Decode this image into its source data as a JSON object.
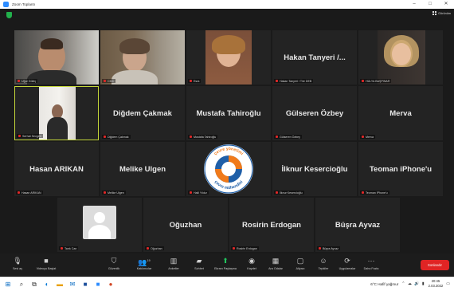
{
  "window": {
    "title": "Zoom Toplantı",
    "controls": [
      "–",
      "□",
      "✕"
    ]
  },
  "meeting": {
    "gallery_view_label": "Görünüm"
  },
  "participants": [
    {
      "id": "ugur",
      "label": "Uğur Güleç",
      "display": "",
      "video": true
    },
    {
      "id": "cmc",
      "label": "CMC",
      "display": "",
      "video": true
    },
    {
      "id": "esra",
      "label": "Esra",
      "display": "",
      "video": true
    },
    {
      "id": "hakan",
      "label": "Hakan Tanyeri / Tire DEB",
      "display": "Hakan Tanyeri /...",
      "video": false
    },
    {
      "id": "hulya",
      "label": "HÜLYA BAŞPINAR",
      "display": "",
      "video": true
    },
    {
      "id": "serhat",
      "label": "Serhat Sevgen",
      "display": "",
      "video": true
    },
    {
      "id": "digdem",
      "label": "Diğdem Çakmak",
      "display": "Diğdem Çakmak",
      "video": false
    },
    {
      "id": "mustafa",
      "label": "Mustafa Tahiroğlu",
      "display": "Mustafa Tahiroğlu",
      "video": false
    },
    {
      "id": "gulseren",
      "label": "Gülseren Özbey",
      "display": "Gülseren Özbey",
      "video": false
    },
    {
      "id": "merva",
      "label": "Merva",
      "display": "Merva",
      "video": false
    },
    {
      "id": "hasan",
      "label": "Hasan ARIKAN",
      "display": "Hasan ARIKAN",
      "video": false
    },
    {
      "id": "melike",
      "label": "Melike Ulgen",
      "display": "Melike Ulgen",
      "video": false
    },
    {
      "id": "halil",
      "label": "Halil Yıldız",
      "display": "",
      "video": false
    },
    {
      "id": "ilknur",
      "label": "İlknur Kesercioğlu",
      "display": "İlknur Kesercioğlu",
      "video": false
    },
    {
      "id": "teoman",
      "label": "Teoman iPhone'u",
      "display": "Teoman iPhone'u",
      "video": false
    },
    {
      "id": "tarik",
      "label": "Tarık Can",
      "display": "",
      "video": false
    },
    {
      "id": "oguzhan",
      "label": "Oğuzhan",
      "display": "Oğuzhan",
      "video": false
    },
    {
      "id": "rosirin",
      "label": "Rosirin Erdogan",
      "display": "Rosirin Erdogan",
      "video": false
    },
    {
      "id": "busra",
      "label": "Büşra Ayvaz",
      "display": "Büşra Ayvaz",
      "video": false
    }
  ],
  "logo": {
    "text_top": "çevre yönetimi",
    "text_bottom": "çevre mühendisi"
  },
  "toolbar": {
    "items": [
      {
        "label": "Sesi aç",
        "icon": "microphone-muted-icon"
      },
      {
        "label": "Videoyu Başlat",
        "icon": "video-off-icon"
      },
      {
        "label": "Güvenlik",
        "icon": "shield-icon"
      },
      {
        "label": "Katılımcılar",
        "icon": "participants-icon",
        "count": "19"
      },
      {
        "label": "Anketler",
        "icon": "polls-icon"
      },
      {
        "label": "Sohbet",
        "icon": "chat-icon"
      },
      {
        "label": "Ekranı Paylaşma",
        "icon": "share-screen-icon"
      },
      {
        "label": "Kaydet",
        "icon": "record-icon"
      },
      {
        "label": "Ara Odalar",
        "icon": "breakout-rooms-icon"
      },
      {
        "label": "Altyazı",
        "icon": "caption-icon"
      },
      {
        "label": "Tepkiler",
        "icon": "reactions-icon"
      },
      {
        "label": "Uygulamalar",
        "icon": "apps-icon"
      },
      {
        "label": "Daha Fazla",
        "icon": "more-icon"
      }
    ],
    "end_label": "Sonlandır"
  },
  "taskbar": {
    "weather": "6°C Hafif yağmur",
    "time": "20:45",
    "date": "2.03.2022"
  },
  "colors": {
    "active_speaker": "#c4d73a",
    "muted_icon": "#e02828",
    "end_button": "#e02424",
    "security_icon": "#22b14c"
  }
}
